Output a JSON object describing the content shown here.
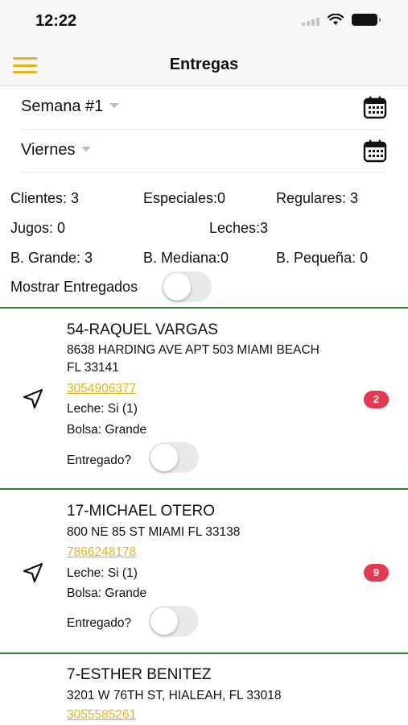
{
  "status_bar": {
    "time": "12:22"
  },
  "header": {
    "title": "Entregas"
  },
  "filters": {
    "week": "Semana #1",
    "day": "Viernes"
  },
  "stats": {
    "clientes": "Clientes: 3",
    "especiales": "Especiales:0",
    "regulares": "Regulares: 3",
    "jugos": "Jugos: 0",
    "leches": "Leches:3",
    "b_grande": "B. Grande: 3",
    "b_mediana": "B. Mediana:0",
    "b_pequena": "B. Pequeña: 0",
    "mostrar_entregados": "Mostrar Entregados",
    "mostrar_entregados_on": false
  },
  "deliveries": [
    {
      "name": "54-RAQUEL VARGAS",
      "address": "8638 HARDING AVE APT 503 MIAMI BEACH FL 33141",
      "phone": "3054906377",
      "leche": "Leche: Si (1)",
      "bolsa": "Bolsa: Grande",
      "entregado_label": "Entregado?",
      "entregado_on": false,
      "badge": "2"
    },
    {
      "name": "17-MICHAEL OTERO",
      "address": "800 NE 85 ST MIAMI FL 33138",
      "phone": "7866248178",
      "leche": "Leche: Si (1)",
      "bolsa": "Bolsa: Grande",
      "entregado_label": "Entregado?",
      "entregado_on": false,
      "badge": "9"
    },
    {
      "name": "7-ESTHER BENITEZ",
      "address": "3201 W 76TH ST, HIALEAH, FL 33018",
      "phone": "3055585261"
    }
  ],
  "colors": {
    "accent": "#e8b21a",
    "divider": "#2e7d32",
    "badge": "#e53950"
  },
  "icons": {
    "menu": "hamburger-menu-icon",
    "calendar": "calendar-icon",
    "navigate": "navigation-arrow-icon"
  }
}
